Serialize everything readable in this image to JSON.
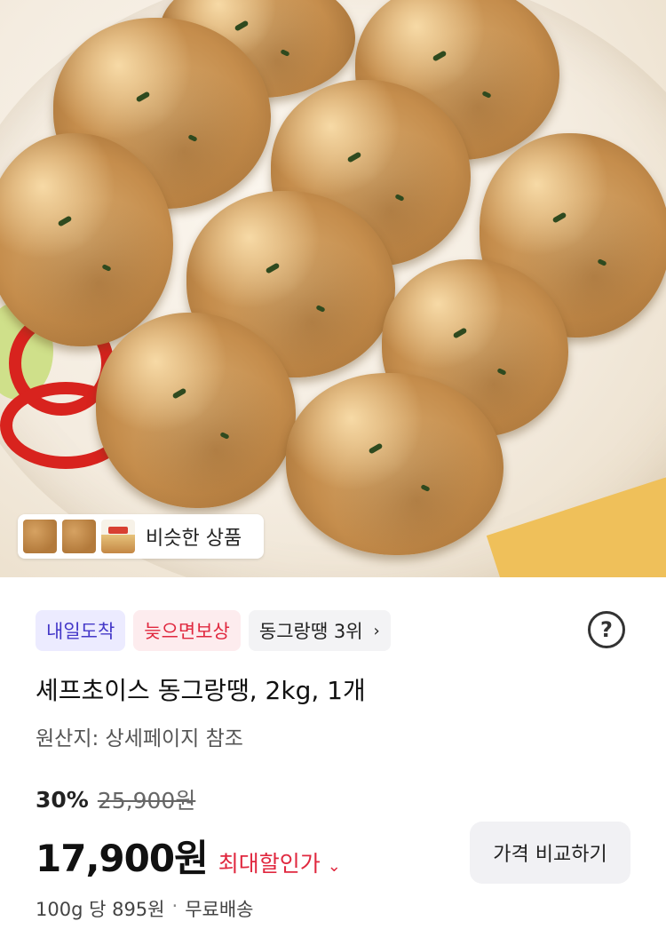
{
  "hero": {
    "image": "meatballs-product-photo",
    "similar": {
      "label": "비슷한 상품"
    }
  },
  "product": {
    "tags": [
      {
        "label": "내일도착",
        "color": "#4438c8"
      },
      {
        "label": "늦으면보상",
        "color": "#e0283f"
      },
      {
        "label": "동그랑땡 3위"
      }
    ],
    "help_icon": "question-circle-icon",
    "title": "셰프초이스 동그랑땡, 2kg, 1개",
    "origin": "원산지: 상세페이지 참조",
    "discount_rate": "30%",
    "original_price": "25,900원",
    "price": "17,900원",
    "max_discount_label": "최대할인가",
    "compare_button": "가격 비교하기",
    "unit_price": "100g 당 895원",
    "shipping": "무료배송"
  },
  "colors": {
    "accent_red": "#e0283f",
    "accent_blue": "#4438c8"
  }
}
